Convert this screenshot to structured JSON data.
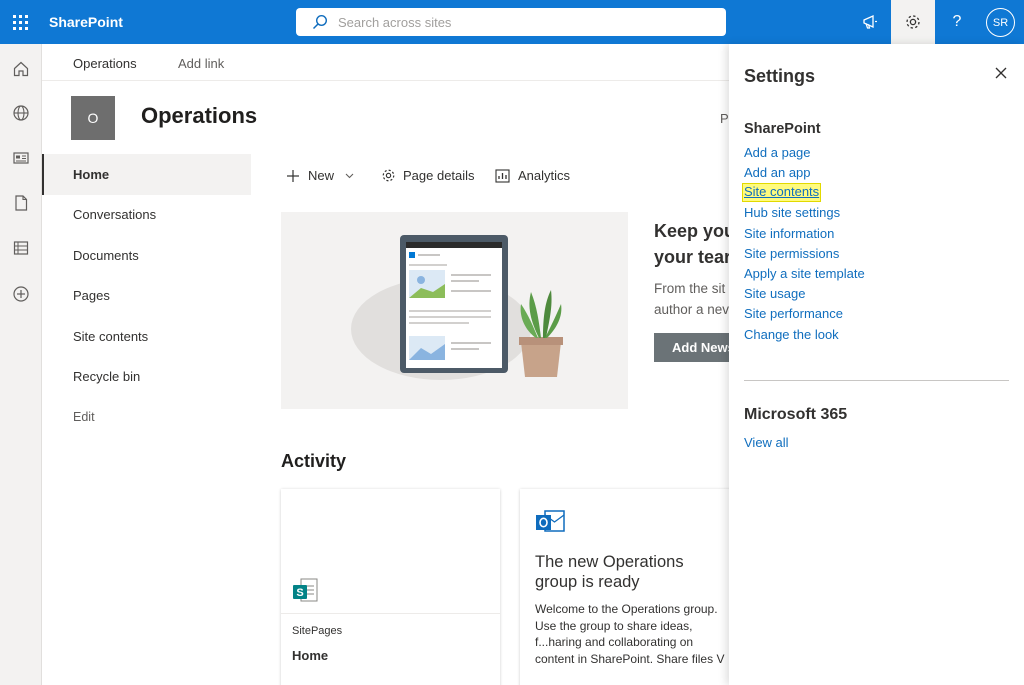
{
  "topbar": {
    "app_name": "SharePoint",
    "search_placeholder": "Search across sites",
    "avatar_initials": "SR",
    "help_label": "?"
  },
  "hub_nav": {
    "items": [
      "Operations",
      "Add link"
    ]
  },
  "site": {
    "logo_letter": "O",
    "title": "Operations",
    "clipped_letter": "P"
  },
  "left_nav": {
    "items": [
      "Home",
      "Conversations",
      "Documents",
      "Pages",
      "Site contents",
      "Recycle bin"
    ],
    "edit_label": "Edit"
  },
  "command_bar": {
    "new_label": "New",
    "page_details_label": "Page details",
    "analytics_label": "Analytics"
  },
  "hero": {
    "heading_line1": "Keep you",
    "heading_line2": "your tear",
    "body_line1": "From the sit",
    "body_line2": "author a nev",
    "button_label": "Add News"
  },
  "activity": {
    "heading": "Activity",
    "card1": {
      "source": "SitePages",
      "title": "Home"
    },
    "card2": {
      "title": "The new Operations group is ready",
      "body": "Welcome to the Operations group. Use the group to share ideas, f...haring and collaborating on content in SharePoint. Share files V"
    }
  },
  "settings_panel": {
    "title": "Settings",
    "sharepoint_heading": "SharePoint",
    "links": [
      "Add a page",
      "Add an app",
      "Site contents",
      "Hub site settings",
      "Site information",
      "Site permissions",
      "Apply a site template",
      "Site usage",
      "Site performance",
      "Change the look"
    ],
    "highlighted_link": "Site contents",
    "m365_heading": "Microsoft 365",
    "view_all_label": "View all"
  },
  "colors": {
    "suite_bar": "#0f78d4",
    "link": "#106ebe",
    "highlight": "#fffb7d"
  }
}
